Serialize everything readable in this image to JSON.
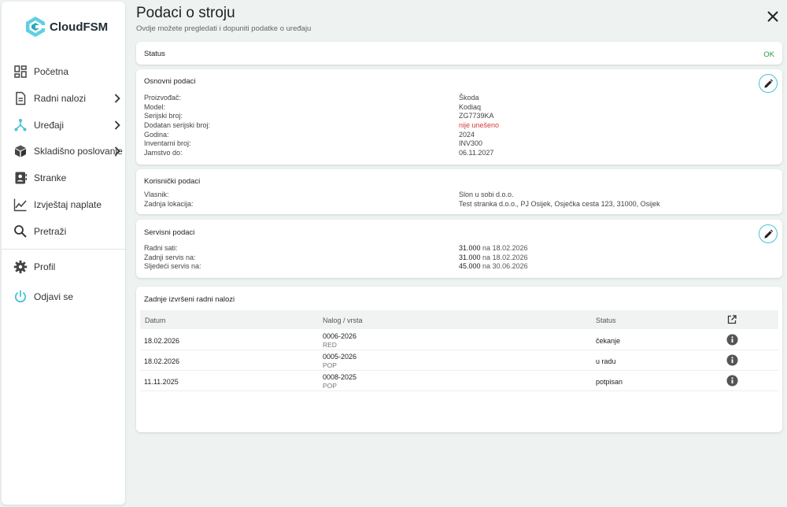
{
  "app": {
    "name": "CloudFSM"
  },
  "sidebar": {
    "items": [
      {
        "label": "Početna",
        "icon": "dashboard-icon"
      },
      {
        "label": "Radni nalozi",
        "icon": "document-icon"
      },
      {
        "label": "Uređaji",
        "icon": "devices-icon"
      },
      {
        "label": "Skladišno poslovanje",
        "icon": "box-icon"
      },
      {
        "label": "Stranke",
        "icon": "contact-icon"
      },
      {
        "label": "Izvještaj naplate",
        "icon": "chart-icon"
      },
      {
        "label": "Pretraži",
        "icon": "search-icon"
      },
      {
        "label": "Profil",
        "icon": "gear-icon"
      },
      {
        "label": "Odjavi se",
        "icon": "power-icon"
      }
    ]
  },
  "page": {
    "title": "Podaci o stroju",
    "subtitle": "Ovdje možete pregledati i dopuniti podatke o uređaju"
  },
  "status": {
    "title": "Status",
    "value": "OK",
    "color": "#2e9a3e"
  },
  "osnovni": {
    "title": "Osnovni podaci",
    "rows": [
      {
        "key": "Proizvođač:",
        "value": "Škoda"
      },
      {
        "key": "Model:",
        "value": "Kodiaq"
      },
      {
        "key": "Serijski broj:",
        "value": "ZG7739KA"
      },
      {
        "key": "Dodatan serijski broj:",
        "value": "nije unešeno"
      },
      {
        "key": "Godina:",
        "value": "2024"
      },
      {
        "key": "Inventarni broj:",
        "value": "INV300"
      },
      {
        "key": "Jamstvo do:",
        "value": "06.11.2027"
      }
    ]
  },
  "korisnicki": {
    "title": "Korisnički podaci",
    "rows": [
      {
        "key": "Vlasnik:",
        "value": "Slon u sobi d.o.o."
      },
      {
        "key": "Zadnja lokacija:",
        "value": "Test stranka d.o.o., PJ Osijek, Osječka cesta 123, 31000, Osijek"
      }
    ]
  },
  "servisni": {
    "title": "Servisni podaci",
    "rows": [
      {
        "key": "Radni sati:",
        "value": "31.000",
        "on": "na",
        "date": "18.02.2026"
      },
      {
        "key": "Zadnji servis na:",
        "value": "31.000",
        "on": "na",
        "date": "18.02.2026"
      },
      {
        "key": "Sljedeći servis na:",
        "value": "45.000",
        "on": "na",
        "date": "30.06.2026"
      }
    ]
  },
  "nalozi": {
    "title": "Zadnje izvršeni radni nalozi",
    "headers": {
      "date": "Datum",
      "order": "Nalog / vrsta",
      "status": "Status"
    },
    "rows": [
      {
        "date": "18.02.2026",
        "order": "0006-2026",
        "type": "RED",
        "status": "čekanje"
      },
      {
        "date": "18.02.2026",
        "order": "0005-2026",
        "type": "POP",
        "status": "u radu"
      },
      {
        "date": "11.11.2025",
        "order": "0008-2025",
        "type": "POP",
        "status": "potpisan"
      }
    ]
  },
  "colors": {
    "accent": "#48c2d6",
    "background": "#eef3f1",
    "danger": "#d63b3b"
  }
}
